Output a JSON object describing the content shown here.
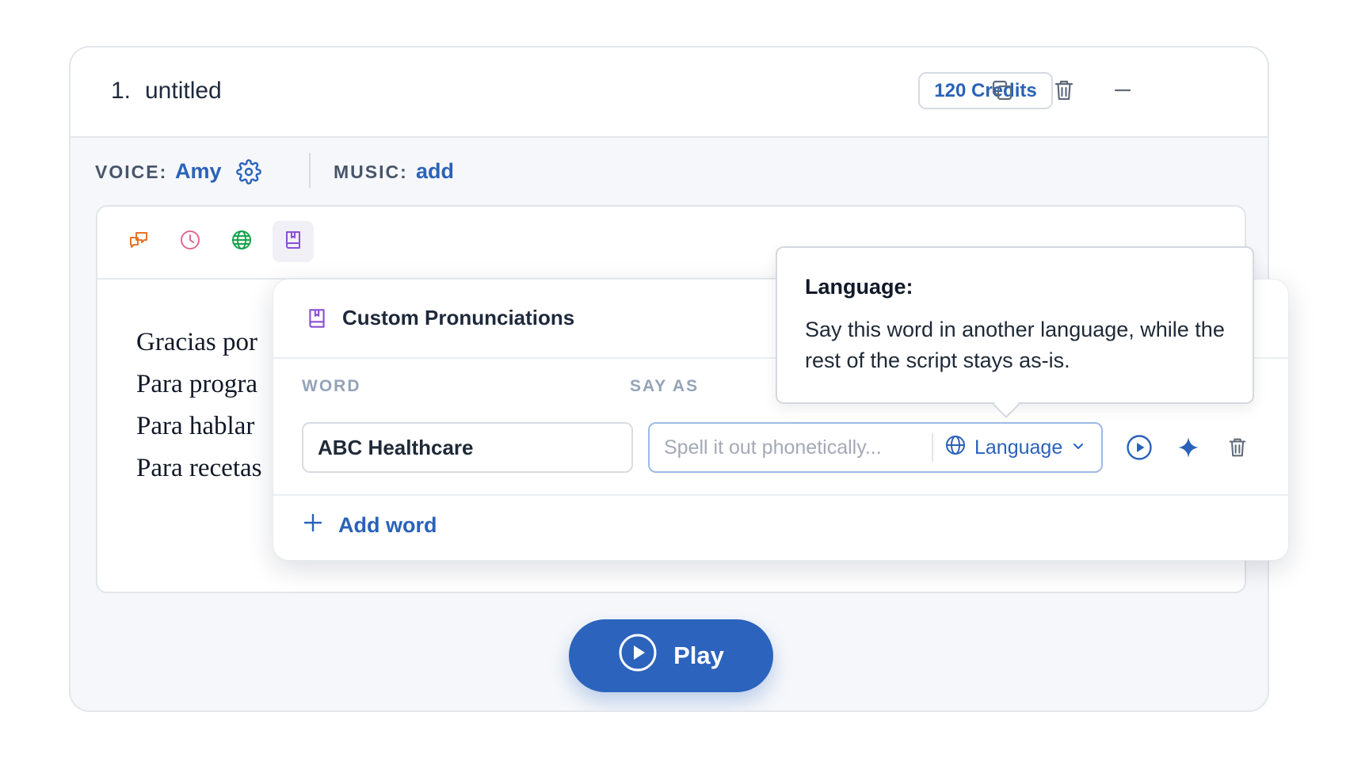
{
  "card": {
    "number": "1.",
    "title": "untitled",
    "credits": "120 Credits",
    "icons": [
      "duplicate-icon",
      "trash-icon",
      "minimize-icon"
    ]
  },
  "meta": {
    "voice_label": "VOICE:",
    "voice_value": "Amy",
    "music_label": "MUSIC:",
    "music_value": "add"
  },
  "toolbar": {
    "tools": [
      {
        "name": "tool-dialogue",
        "icon": "chat-bubbles-icon",
        "color": "#e8732a"
      },
      {
        "name": "tool-pause",
        "icon": "clock-icon",
        "color": "#e06a8f"
      },
      {
        "name": "tool-language",
        "icon": "globe-icon",
        "color": "#16a34a"
      },
      {
        "name": "tool-pronunciations",
        "icon": "book-icon",
        "color": "#8b4fd6",
        "active": true
      }
    ]
  },
  "script_lines": [
    "Gracias por",
    "Para progra",
    "Para hablar",
    "Para recetas"
  ],
  "pronunciations": {
    "title": "Custom Pronunciations",
    "col_word": "WORD",
    "col_say_as": "SAY AS",
    "row": {
      "word": "ABC Healthcare",
      "say_as_value": "",
      "say_as_placeholder": "Spell it out phonetically...",
      "language_label": "Language"
    },
    "add_word": "Add word"
  },
  "tooltip": {
    "title": "Language:",
    "body": "Say this word in another language, while the rest of the script stays as-is."
  },
  "play_label": "Play",
  "colors": {
    "accent": "#2a62b8",
    "play_button": "#2c63bd",
    "card_bg": "#f5f7fa"
  }
}
